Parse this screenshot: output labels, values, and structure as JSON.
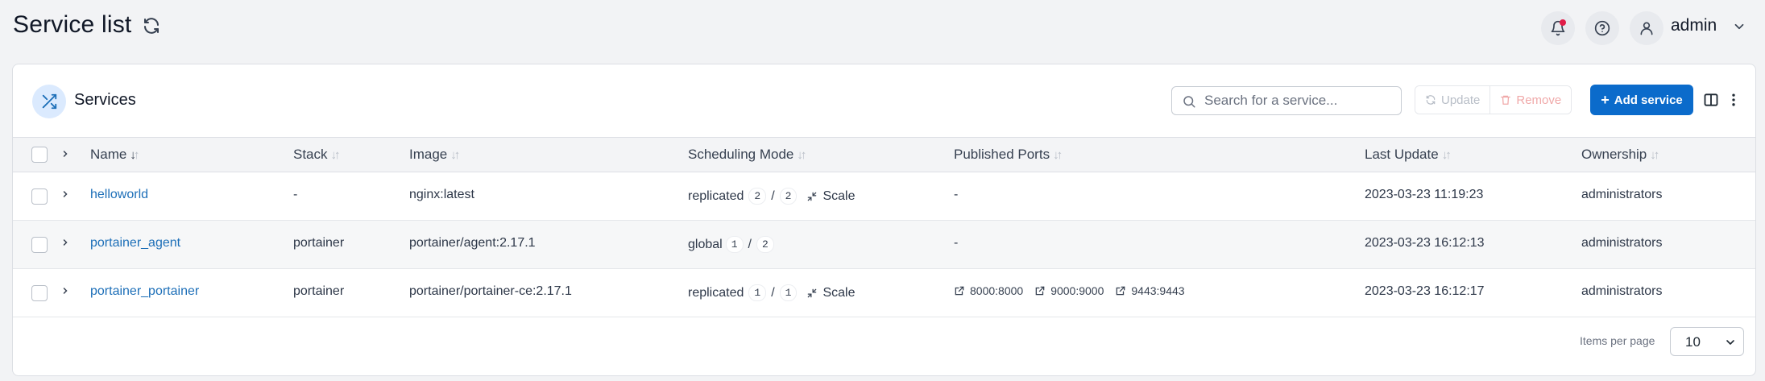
{
  "header": {
    "title": "Service list",
    "user": "admin"
  },
  "card": {
    "title": "Services",
    "search_placeholder": "Search for a service...",
    "update_label": "Update",
    "remove_label": "Remove",
    "add_label": "Add service"
  },
  "table": {
    "columns": {
      "name": "Name",
      "stack": "Stack",
      "image": "Image",
      "mode": "Scheduling Mode",
      "ports": "Published Ports",
      "updated": "Last Update",
      "ownership": "Ownership"
    },
    "rows": [
      {
        "name": "helloworld",
        "stack": "-",
        "image": "nginx:latest",
        "mode": "replicated",
        "running": "2",
        "desired": "2",
        "scale": "Scale",
        "ports_text": "-",
        "updated": "2023-03-23 11:19:23",
        "ownership": "administrators"
      },
      {
        "name": "portainer_agent",
        "stack": "portainer",
        "image": "portainer/agent:2.17.1",
        "mode": "global",
        "running": "1",
        "desired": "2",
        "ports_text": "-",
        "updated": "2023-03-23 16:12:13",
        "ownership": "administrators"
      },
      {
        "name": "portainer_portainer",
        "stack": "portainer",
        "image": "portainer/portainer-ce:2.17.1",
        "mode": "replicated",
        "running": "1",
        "desired": "1",
        "scale": "Scale",
        "ports": [
          "8000:8000",
          "9000:9000",
          "9443:9443"
        ],
        "updated": "2023-03-23 16:12:17",
        "ownership": "administrators"
      }
    ]
  },
  "footer": {
    "items_per_page_label": "Items per page",
    "items_per_page_value": "10"
  },
  "colors": {
    "primary": "#0b6bcb",
    "link": "#1d6fb8",
    "notification_dot": "#e11d48"
  }
}
